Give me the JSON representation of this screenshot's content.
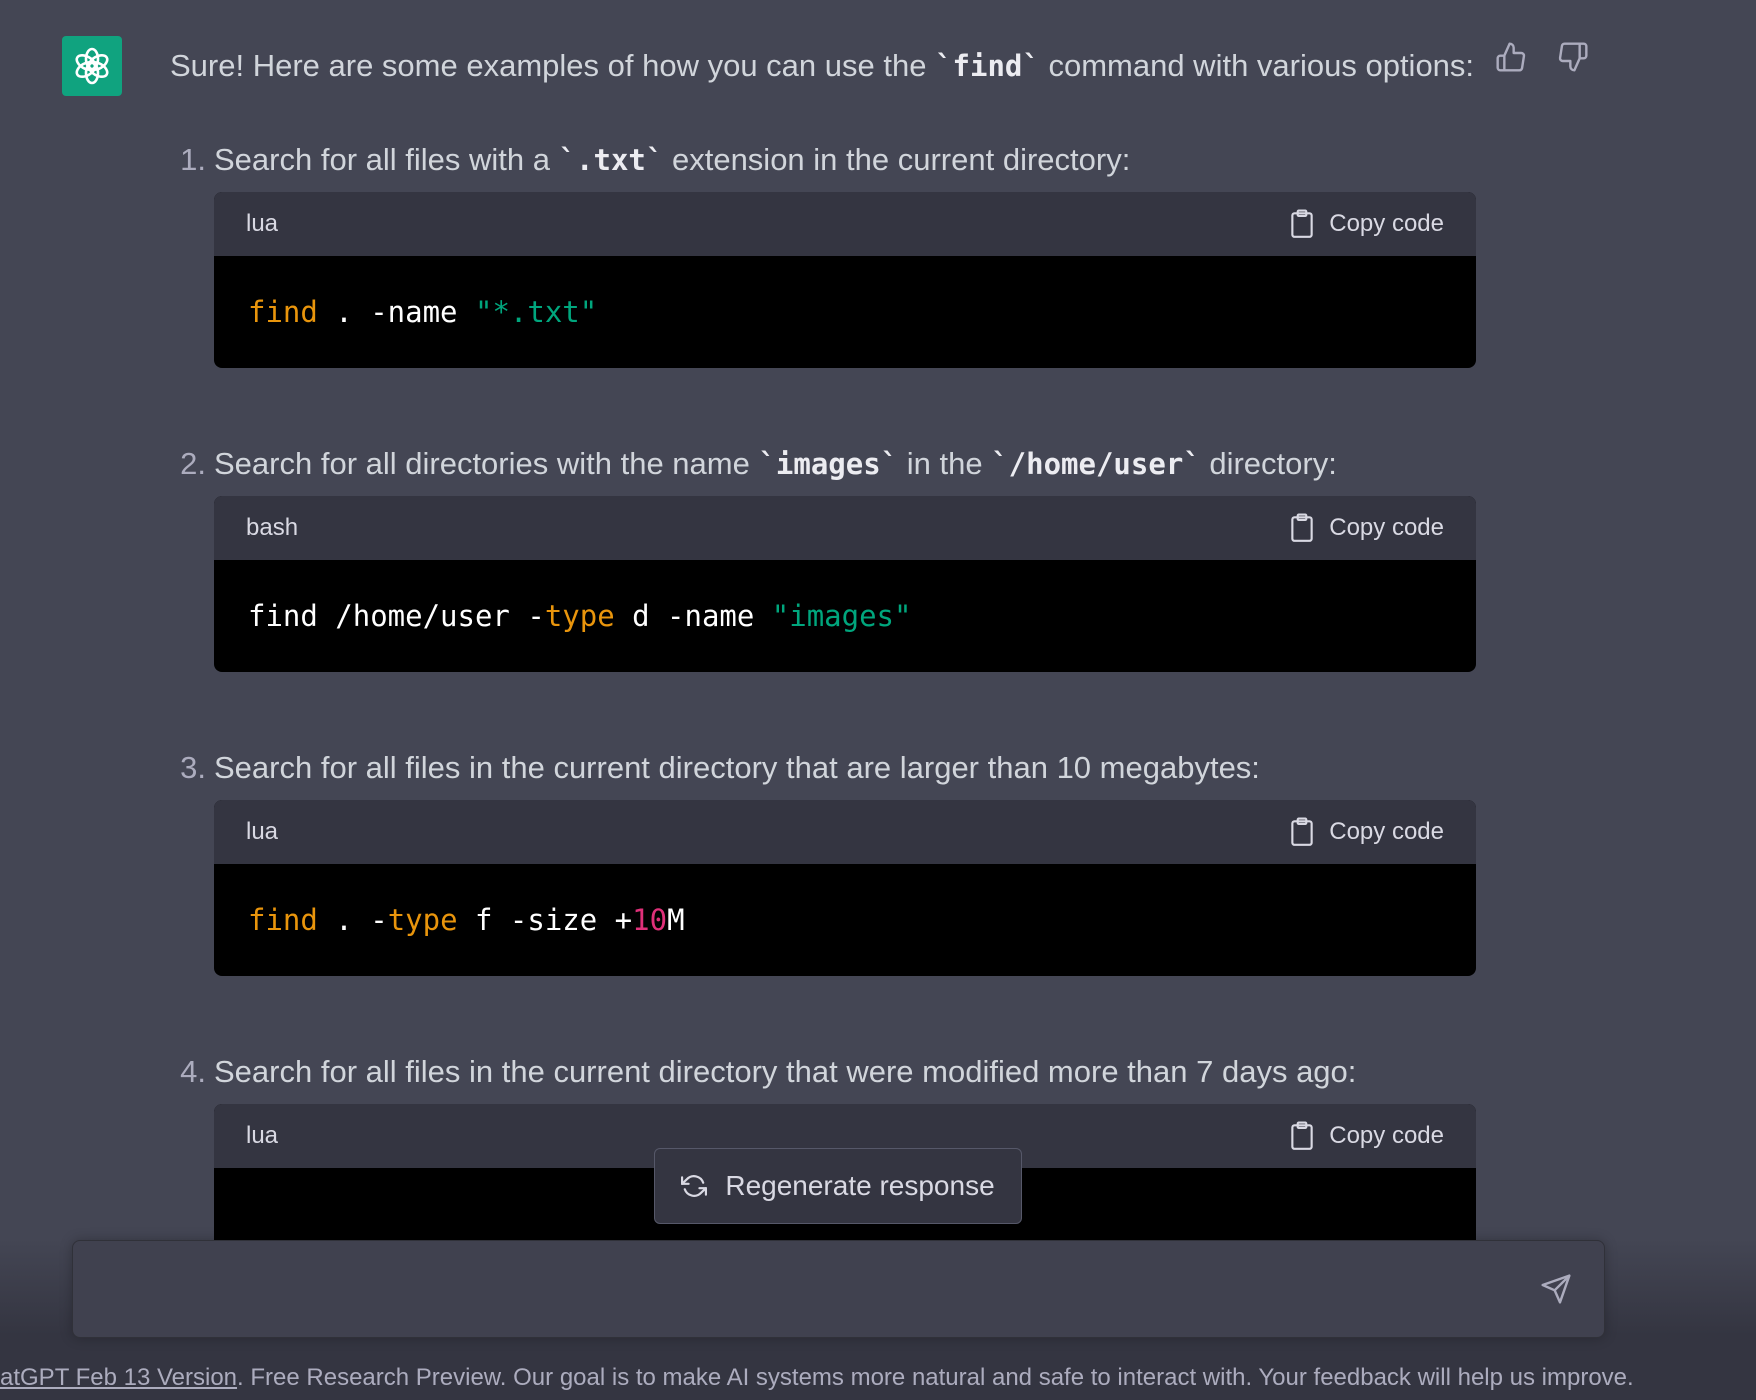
{
  "message": {
    "intro_before": "Sure! Here are some examples of how you can use the ",
    "intro_code": "`find`",
    "intro_after": " command with various options:"
  },
  "steps": [
    {
      "number": "1.",
      "title_parts": [
        "Search for all files with a ",
        "`.txt`",
        " extension in the current directory:"
      ],
      "language": "lua",
      "copy_label": "Copy code",
      "code_tokens": [
        {
          "t": "find",
          "c": "k"
        },
        {
          "t": " . -name ",
          "c": ""
        },
        {
          "t": "\"*.txt\"",
          "c": "s"
        }
      ]
    },
    {
      "number": "2.",
      "title_parts": [
        "Search for all directories with the name ",
        "`images`",
        " in the ",
        "`/home/user`",
        " directory:"
      ],
      "language": "bash",
      "copy_label": "Copy code",
      "code_tokens": [
        {
          "t": "find /home/user -",
          "c": ""
        },
        {
          "t": "type",
          "c": "k"
        },
        {
          "t": " d -name ",
          "c": ""
        },
        {
          "t": "\"images\"",
          "c": "s"
        }
      ]
    },
    {
      "number": "3.",
      "title_parts": [
        "Search for all files in the current directory that are larger than 10 megabytes:"
      ],
      "language": "lua",
      "copy_label": "Copy code",
      "code_tokens": [
        {
          "t": "find",
          "c": "k"
        },
        {
          "t": " . -",
          "c": ""
        },
        {
          "t": "type",
          "c": "k"
        },
        {
          "t": " f -size +",
          "c": ""
        },
        {
          "t": "10",
          "c": "n"
        },
        {
          "t": "M",
          "c": ""
        }
      ]
    },
    {
      "number": "4.",
      "title_parts": [
        "Search for all files in the current directory that were modified more than 7 days ago:"
      ],
      "language": "lua",
      "copy_label": "Copy code",
      "code_tokens": []
    }
  ],
  "regenerate_label": "Regenerate response",
  "input": {
    "value": "",
    "placeholder": ""
  },
  "footer": {
    "link_text": "atGPT Feb 13 Version",
    "rest": ". Free Research Preview. Our goal is to make AI systems more natural and safe to interact with. Your feedback will help us improve."
  },
  "colors": {
    "accent": "#10a37f",
    "background": "#444654",
    "keyword": "#e9950c",
    "string": "#00a67d",
    "number": "#df3079"
  },
  "icons": [
    "openai-logo-icon",
    "thumbs-up-icon",
    "thumbs-down-icon",
    "clipboard-icon",
    "refresh-icon",
    "send-icon"
  ]
}
